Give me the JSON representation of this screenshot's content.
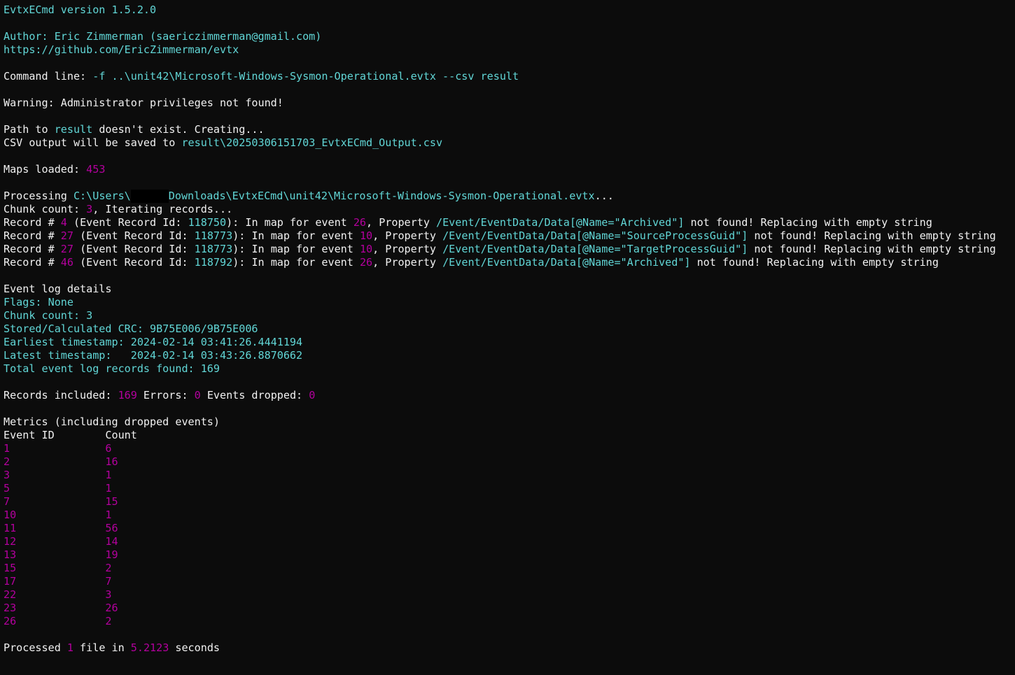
{
  "colors": {
    "background": "#0c0c0c",
    "default": "#f2f2f2",
    "cyan": "#61d6d6",
    "magenta": "#b4009e"
  },
  "lines": [
    {
      "segments": [
        {
          "t": "EvtxECmd version 1.5.2.0",
          "c": "c"
        }
      ]
    },
    {
      "segments": []
    },
    {
      "segments": [
        {
          "t": "Author: Eric Zimmerman (saericzimmerman@gmail.com)",
          "c": "c"
        }
      ]
    },
    {
      "segments": [
        {
          "t": "https://github.com/EricZimmerman/evtx",
          "c": "c"
        }
      ]
    },
    {
      "segments": []
    },
    {
      "segments": [
        {
          "t": "Command line: ",
          "c": "w"
        },
        {
          "t": "-f ..\\unit42\\Microsoft-Windows-Sysmon-Operational.evtx --csv result",
          "c": "c"
        }
      ]
    },
    {
      "segments": []
    },
    {
      "segments": [
        {
          "t": "Warning: Administrator privileges not found!",
          "c": "w"
        }
      ]
    },
    {
      "segments": []
    },
    {
      "segments": [
        {
          "t": "Path to ",
          "c": "w"
        },
        {
          "t": "result",
          "c": "c"
        },
        {
          "t": " doesn't exist. Creating...",
          "c": "w"
        }
      ]
    },
    {
      "segments": [
        {
          "t": "CSV output will be saved to ",
          "c": "w"
        },
        {
          "t": "result\\20250306151703_EvtxECmd_Output.csv",
          "c": "c"
        }
      ]
    },
    {
      "segments": []
    },
    {
      "segments": [
        {
          "t": "Maps loaded: ",
          "c": "w"
        },
        {
          "t": "453",
          "c": "m"
        }
      ]
    },
    {
      "segments": []
    },
    {
      "segments": [
        {
          "t": "Processing ",
          "c": "w"
        },
        {
          "t": "C:\\Users\\",
          "c": "c"
        },
        {
          "redact": true
        },
        {
          "t": "Downloads\\EvtxECmd\\unit42\\Microsoft-Windows-Sysmon-Operational.evtx",
          "c": "c"
        },
        {
          "t": "...",
          "c": "w"
        }
      ]
    },
    {
      "segments": [
        {
          "t": "Chunk count: ",
          "c": "w"
        },
        {
          "t": "3",
          "c": "m"
        },
        {
          "t": ", Iterating records...",
          "c": "w"
        }
      ]
    },
    {
      "segments": [
        {
          "t": "Record # ",
          "c": "w"
        },
        {
          "t": "4",
          "c": "m"
        },
        {
          "t": " (Event Record Id: ",
          "c": "w"
        },
        {
          "t": "118750",
          "c": "c"
        },
        {
          "t": "): In map for event ",
          "c": "w"
        },
        {
          "t": "26",
          "c": "m"
        },
        {
          "t": ", Property ",
          "c": "w"
        },
        {
          "t": "/Event/EventData/Data[@Name=\"Archived\"]",
          "c": "c"
        },
        {
          "t": " not found! Replacing with empty string",
          "c": "w"
        }
      ]
    },
    {
      "segments": [
        {
          "t": "Record # ",
          "c": "w"
        },
        {
          "t": "27",
          "c": "m"
        },
        {
          "t": " (Event Record Id: ",
          "c": "w"
        },
        {
          "t": "118773",
          "c": "c"
        },
        {
          "t": "): In map for event ",
          "c": "w"
        },
        {
          "t": "10",
          "c": "m"
        },
        {
          "t": ", Property ",
          "c": "w"
        },
        {
          "t": "/Event/EventData/Data[@Name=\"SourceProcessGuid\"]",
          "c": "c"
        },
        {
          "t": " not found! Replacing with empty string",
          "c": "w"
        }
      ]
    },
    {
      "segments": [
        {
          "t": "Record # ",
          "c": "w"
        },
        {
          "t": "27",
          "c": "m"
        },
        {
          "t": " (Event Record Id: ",
          "c": "w"
        },
        {
          "t": "118773",
          "c": "c"
        },
        {
          "t": "): In map for event ",
          "c": "w"
        },
        {
          "t": "10",
          "c": "m"
        },
        {
          "t": ", Property ",
          "c": "w"
        },
        {
          "t": "/Event/EventData/Data[@Name=\"TargetProcessGuid\"]",
          "c": "c"
        },
        {
          "t": " not found! Replacing with empty string",
          "c": "w"
        }
      ]
    },
    {
      "segments": [
        {
          "t": "Record # ",
          "c": "w"
        },
        {
          "t": "46",
          "c": "m"
        },
        {
          "t": " (Event Record Id: ",
          "c": "w"
        },
        {
          "t": "118792",
          "c": "c"
        },
        {
          "t": "): In map for event ",
          "c": "w"
        },
        {
          "t": "26",
          "c": "m"
        },
        {
          "t": ", Property ",
          "c": "w"
        },
        {
          "t": "/Event/EventData/Data[@Name=\"Archived\"]",
          "c": "c"
        },
        {
          "t": " not found! Replacing with empty string",
          "c": "w"
        }
      ]
    },
    {
      "segments": []
    },
    {
      "segments": [
        {
          "t": "Event log details",
          "c": "w"
        }
      ]
    },
    {
      "segments": [
        {
          "t": "Flags: None",
          "c": "c"
        }
      ]
    },
    {
      "segments": [
        {
          "t": "Chunk count: 3",
          "c": "c"
        }
      ]
    },
    {
      "segments": [
        {
          "t": "Stored/Calculated CRC: 9B75E006/9B75E006",
          "c": "c"
        }
      ]
    },
    {
      "segments": [
        {
          "t": "Earliest timestamp: 2024-02-14 03:41:26.4441194",
          "c": "c"
        }
      ]
    },
    {
      "segments": [
        {
          "t": "Latest timestamp:   2024-02-14 03:43:26.8870662",
          "c": "c"
        }
      ]
    },
    {
      "segments": [
        {
          "t": "Total event log records found: 169",
          "c": "c"
        }
      ]
    },
    {
      "segments": []
    },
    {
      "segments": [
        {
          "t": "Records included: ",
          "c": "w"
        },
        {
          "t": "169",
          "c": "m"
        },
        {
          "t": " Errors: ",
          "c": "w"
        },
        {
          "t": "0",
          "c": "m"
        },
        {
          "t": " Events dropped: ",
          "c": "w"
        },
        {
          "t": "0",
          "c": "m"
        }
      ]
    },
    {
      "segments": []
    },
    {
      "segments": [
        {
          "t": "Metrics (including dropped events)",
          "c": "w"
        }
      ]
    },
    {
      "segments": [
        {
          "t": "Event ID        Count",
          "c": "w"
        }
      ]
    },
    {
      "segments": [
        {
          "t": "1               ",
          "c": "m"
        },
        {
          "t": "6",
          "c": "m"
        }
      ]
    },
    {
      "segments": [
        {
          "t": "2               ",
          "c": "m"
        },
        {
          "t": "16",
          "c": "m"
        }
      ]
    },
    {
      "segments": [
        {
          "t": "3               ",
          "c": "m"
        },
        {
          "t": "1",
          "c": "m"
        }
      ]
    },
    {
      "segments": [
        {
          "t": "5               ",
          "c": "m"
        },
        {
          "t": "1",
          "c": "m"
        }
      ]
    },
    {
      "segments": [
        {
          "t": "7               ",
          "c": "m"
        },
        {
          "t": "15",
          "c": "m"
        }
      ]
    },
    {
      "segments": [
        {
          "t": "10              ",
          "c": "m"
        },
        {
          "t": "1",
          "c": "m"
        }
      ]
    },
    {
      "segments": [
        {
          "t": "11              ",
          "c": "m"
        },
        {
          "t": "56",
          "c": "m"
        }
      ]
    },
    {
      "segments": [
        {
          "t": "12              ",
          "c": "m"
        },
        {
          "t": "14",
          "c": "m"
        }
      ]
    },
    {
      "segments": [
        {
          "t": "13              ",
          "c": "m"
        },
        {
          "t": "19",
          "c": "m"
        }
      ]
    },
    {
      "segments": [
        {
          "t": "15              ",
          "c": "m"
        },
        {
          "t": "2",
          "c": "m"
        }
      ]
    },
    {
      "segments": [
        {
          "t": "17              ",
          "c": "m"
        },
        {
          "t": "7",
          "c": "m"
        }
      ]
    },
    {
      "segments": [
        {
          "t": "22              ",
          "c": "m"
        },
        {
          "t": "3",
          "c": "m"
        }
      ]
    },
    {
      "segments": [
        {
          "t": "23              ",
          "c": "m"
        },
        {
          "t": "26",
          "c": "m"
        }
      ]
    },
    {
      "segments": [
        {
          "t": "26              ",
          "c": "m"
        },
        {
          "t": "2",
          "c": "m"
        }
      ]
    },
    {
      "segments": []
    },
    {
      "segments": [
        {
          "t": "Processed ",
          "c": "w"
        },
        {
          "t": "1",
          "c": "m"
        },
        {
          "t": " file in ",
          "c": "w"
        },
        {
          "t": "5.2123",
          "c": "m"
        },
        {
          "t": " seconds",
          "c": "w"
        }
      ]
    }
  ]
}
